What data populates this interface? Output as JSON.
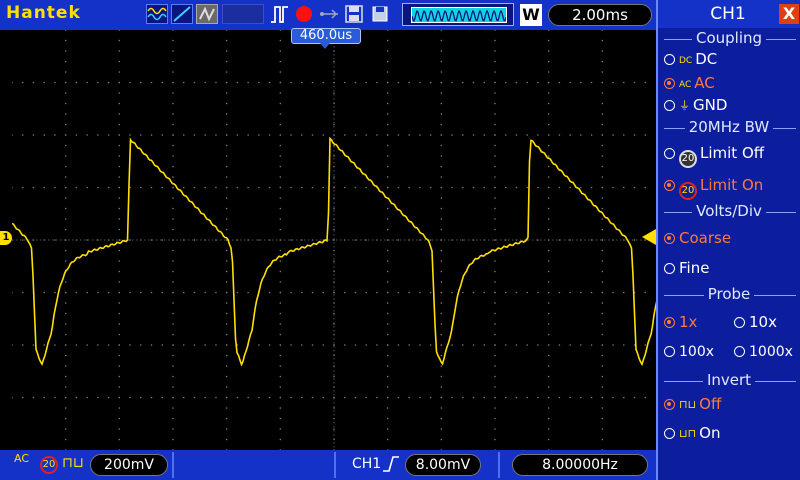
{
  "header": {
    "brand": "Hantek",
    "w_badge": "W",
    "timebase": "2.00ms"
  },
  "screen": {
    "trigger_position": "460.0us",
    "ch1_marker": "1"
  },
  "bottom": {
    "coupling_symbol": "AC",
    "bw_symbol": "20",
    "volts_div": "200mV",
    "trigger_channel": "CH1",
    "trigger_level": "8.00mV",
    "frequency": "8.00000Hz"
  },
  "panel": {
    "title": "CH1",
    "close": "X",
    "coupling": {
      "title": "Coupling",
      "options": [
        {
          "icon": "DC",
          "label": "DC",
          "selected": false
        },
        {
          "icon": "AC",
          "label": "AC",
          "selected": true
        },
        {
          "icon": "GND",
          "label": "GND",
          "selected": false
        }
      ]
    },
    "bw": {
      "title": "20MHz BW",
      "icon": "20",
      "options": [
        {
          "label": "Limit Off",
          "selected": false
        },
        {
          "label": "Limit On",
          "selected": true
        }
      ]
    },
    "volts": {
      "title": "Volts/Div",
      "options": [
        {
          "label": "Coarse",
          "selected": true
        },
        {
          "label": "Fine",
          "selected": false
        }
      ]
    },
    "probe": {
      "title": "Probe",
      "options": [
        {
          "label": "1x",
          "selected": true
        },
        {
          "label": "10x",
          "selected": false
        },
        {
          "label": "100x",
          "selected": false
        },
        {
          "label": "1000x",
          "selected": false
        }
      ]
    },
    "invert": {
      "title": "Invert",
      "options": [
        {
          "label": "Off",
          "selected": true
        },
        {
          "label": "On",
          "selected": false
        }
      ]
    }
  },
  "colors": {
    "trace": "#ffe000",
    "selected": "#ff7a3a",
    "bar": "#1432c8"
  }
}
